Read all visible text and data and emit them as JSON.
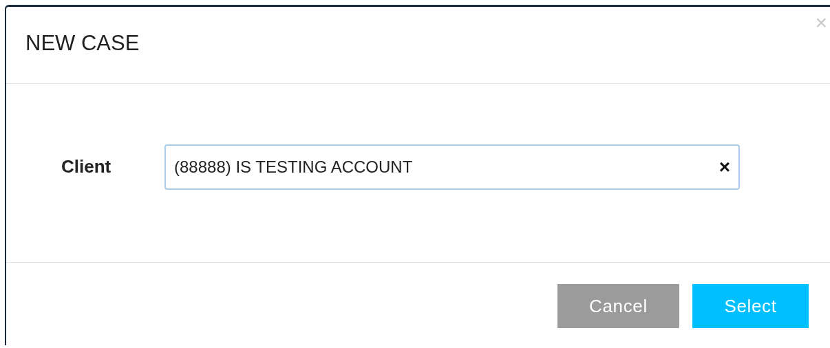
{
  "dialog": {
    "title": "NEW CASE",
    "close": "×"
  },
  "field": {
    "label": "Client",
    "value": "(88888) IS TESTING ACCOUNT",
    "clear": "×"
  },
  "buttons": [
    {
      "kind": "secondary",
      "label": "Cancel"
    },
    {
      "kind": "primary",
      "label": "Select"
    }
  ]
}
